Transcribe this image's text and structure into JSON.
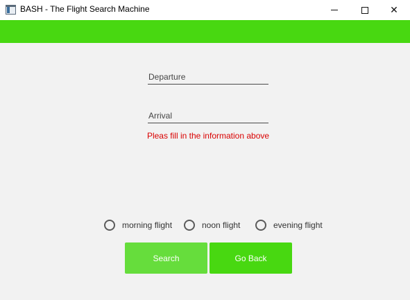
{
  "window": {
    "title": "BASH - The Flight Search Machine",
    "minimize_icon": "minimize-icon",
    "maximize_icon": "maximize-icon",
    "close_glyph": "✕"
  },
  "colors": {
    "accent": "#48d811",
    "search_button": "#66dd3c",
    "error": "#d90000",
    "background": "#f2f2f2"
  },
  "form": {
    "departure_placeholder": "Departure",
    "departure_value": "",
    "arrival_placeholder": "Arrival",
    "arrival_value": "",
    "error_message": "Pleas fill in the information above"
  },
  "time_options": [
    {
      "label": "morning flight",
      "selected": false
    },
    {
      "label": "noon flight",
      "selected": false
    },
    {
      "label": "evening flight",
      "selected": false
    }
  ],
  "buttons": {
    "search": "Search",
    "go_back": "Go Back"
  }
}
